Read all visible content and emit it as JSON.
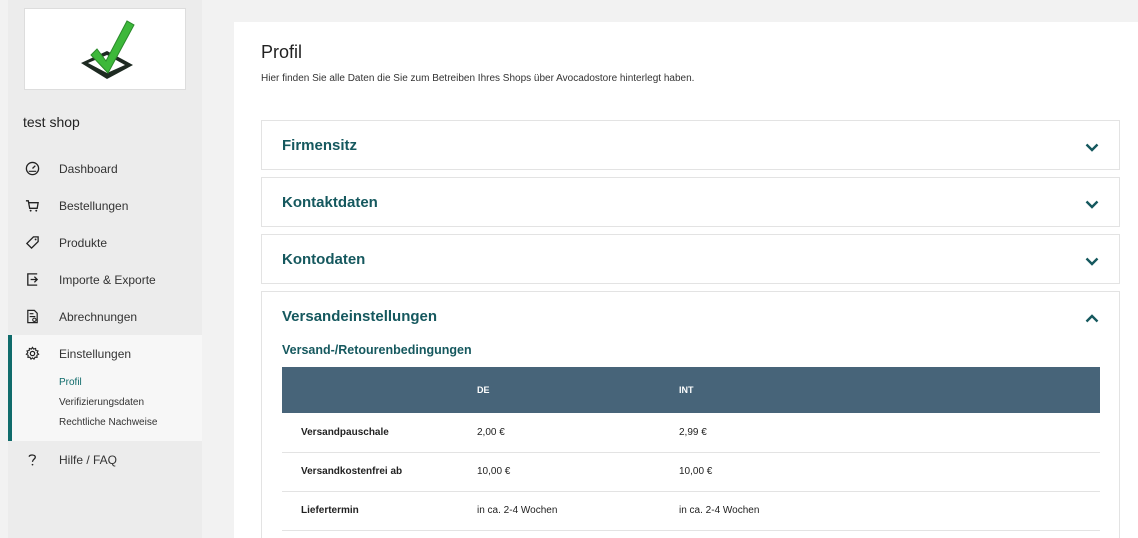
{
  "sidebar": {
    "shop_name": "test shop",
    "items": [
      {
        "label": "Dashboard",
        "icon": "gauge-icon"
      },
      {
        "label": "Bestellungen",
        "icon": "cart-icon"
      },
      {
        "label": "Produkte",
        "icon": "tag-icon"
      },
      {
        "label": "Importe & Exporte",
        "icon": "import-icon"
      },
      {
        "label": "Abrechnungen",
        "icon": "invoice-icon"
      }
    ],
    "settings": {
      "label": "Einstellungen",
      "icon": "gear-icon",
      "subitems": [
        "Profil",
        "Verifizierungsdaten",
        "Rechtliche Nachweise"
      ]
    },
    "help": {
      "label": "Hilfe / FAQ",
      "icon": "question-icon"
    }
  },
  "main": {
    "title": "Profil",
    "description": "Hier finden Sie alle Daten die Sie zum Betreiben Ihres Shops über Avocadostore hinterlegt haben.",
    "panels": [
      {
        "title": "Firmensitz",
        "expanded": false
      },
      {
        "title": "Kontaktdaten",
        "expanded": false
      },
      {
        "title": "Kontodaten",
        "expanded": false
      },
      {
        "title": "Versandeinstellungen",
        "expanded": true
      }
    ],
    "shipping": {
      "subtitle": "Versand-/Retourenbedingungen",
      "headers": [
        "",
        "DE",
        "INT"
      ],
      "rows": [
        [
          "Versandpauschale",
          "2,00 €",
          "2,99 €"
        ],
        [
          "Versandkostenfrei ab",
          "10,00 €",
          "10,00 €"
        ],
        [
          "Liefertermin",
          "in ca. 2-4 Wochen",
          "in ca. 2-4 Wochen"
        ]
      ]
    }
  },
  "colors": {
    "accent": "#15585e",
    "table_header": "#476479",
    "sidebar_bg": "#ececec"
  }
}
